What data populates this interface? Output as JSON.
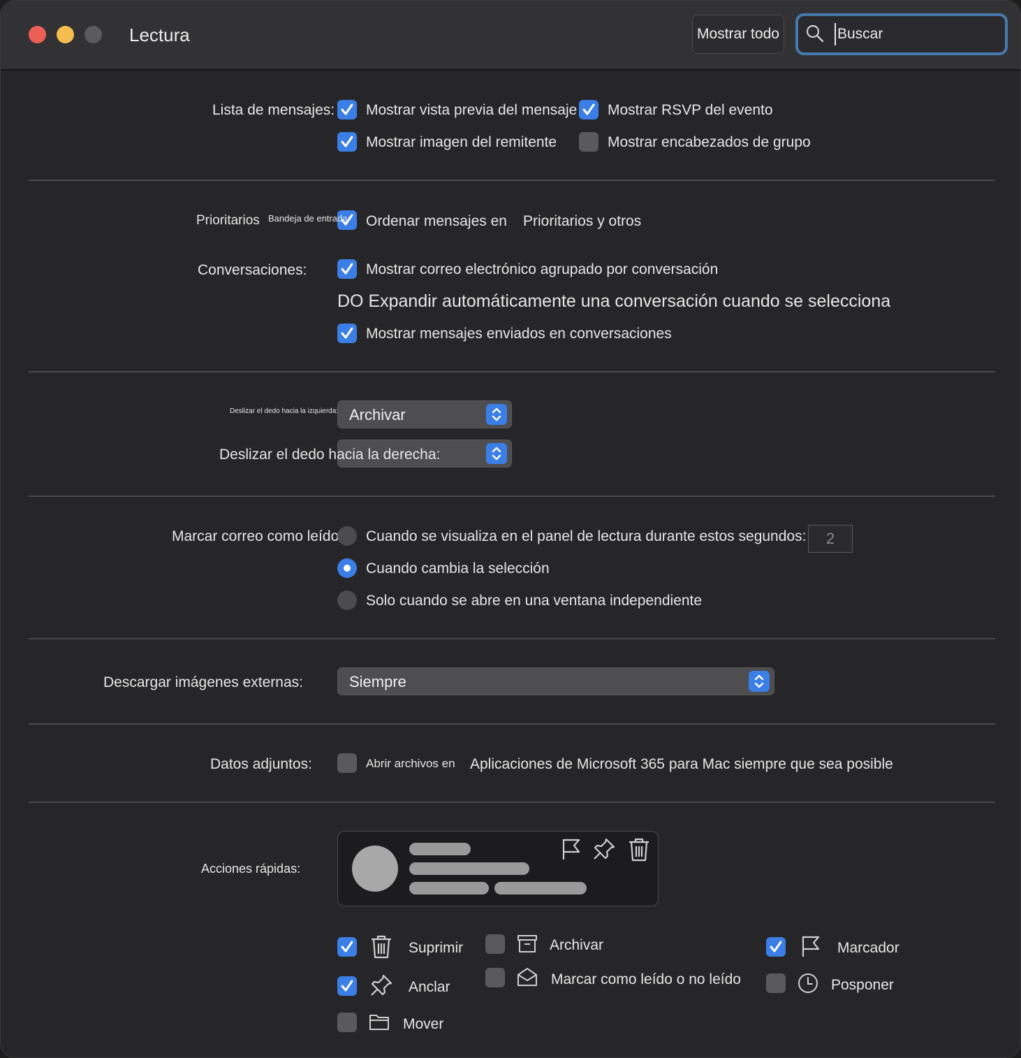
{
  "window": {
    "title": "Lectura"
  },
  "toolbar": {
    "show_all": "Mostrar todo",
    "search_placeholder": "Buscar"
  },
  "message_list": {
    "label": "Lista de mensajes:",
    "options": [
      {
        "label": "Mostrar vista previa del mensaje",
        "checked": true
      },
      {
        "label": "Mostrar RSVP del evento",
        "checked": true
      },
      {
        "label": "Mostrar imagen del remitente",
        "checked": true
      },
      {
        "label": "Mostrar encabezados de grupo",
        "checked": false
      }
    ]
  },
  "focused": {
    "label_a": "Prioritarios",
    "label_b": "Bandeja de entrada:",
    "option": "Ordenar mensajes en",
    "option_suffix": "Prioritarios y otros",
    "checked": true
  },
  "conversations": {
    "label": "Conversaciones:",
    "group": {
      "label": "Mostrar correo electrónico agrupado por conversación",
      "checked": true
    },
    "expand": "DO Expandir automáticamente una conversación cuando se selecciona",
    "sent": {
      "label": "Mostrar mensajes enviados en conversaciones",
      "checked": true
    }
  },
  "swipe": {
    "left_label": "Deslizar el dedo hacia la izquierda:",
    "left_value": "Archivar",
    "right_label": "Deslizar el dedo hacia la derecha:",
    "right_value": ""
  },
  "mark_read": {
    "label": "Marcar correo como leído:",
    "options": [
      {
        "label": "Cuando se visualiza en el panel de lectura durante estos segundos:",
        "selected": false
      },
      {
        "label": "Cuando cambia la selección",
        "selected": true
      },
      {
        "label": "Solo cuando se abre en una ventana independiente",
        "selected": false
      }
    ],
    "seconds": "2"
  },
  "external_images": {
    "label": "Descargar imágenes externas:",
    "value": "Siempre"
  },
  "attachments": {
    "label": "Datos adjuntos:",
    "option": "Abrir archivos en",
    "option_suffix": "Aplicaciones de Microsoft 365 para Mac siempre que sea posible",
    "checked": false
  },
  "quick_actions": {
    "label": "Acciones rápidas:",
    "items": [
      {
        "label": "Suprimir",
        "icon": "trash-icon",
        "checked": true
      },
      {
        "label": "Archivar",
        "icon": "archive-icon",
        "checked": false
      },
      {
        "label": "Marcador",
        "icon": "flag-icon",
        "checked": true
      },
      {
        "label": "Anclar",
        "icon": "pin-icon",
        "checked": true
      },
      {
        "label": "Marcar como leído o no leído",
        "icon": "envelope-open-icon",
        "checked": false
      },
      {
        "label": "Posponer",
        "icon": "clock-icon",
        "checked": false
      },
      {
        "label": "Mover",
        "icon": "folder-icon",
        "checked": false
      }
    ]
  },
  "colors": {
    "accent": "#3b7ee6",
    "background": "#262628",
    "titlebar": "#323234"
  }
}
